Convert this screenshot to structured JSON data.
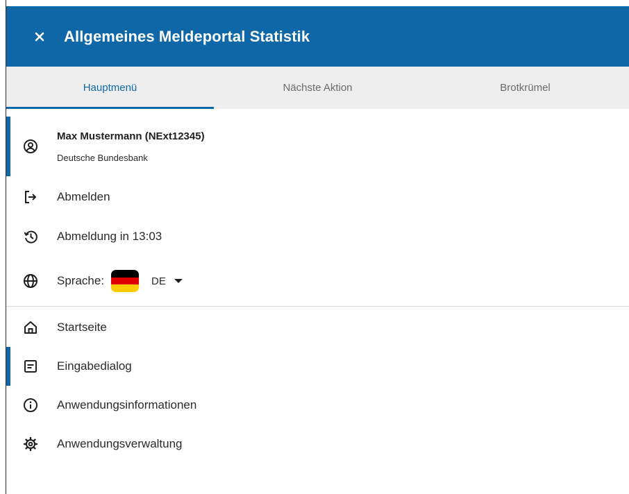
{
  "header": {
    "title": "Allgemeines Meldeportal Statistik",
    "close_icon": "close-icon",
    "background": "#0f67a7"
  },
  "tabs": [
    {
      "label": "Hauptmenü",
      "active": true
    },
    {
      "label": "Nächste Aktion",
      "active": false
    },
    {
      "label": "Brotkrümel",
      "active": false
    }
  ],
  "user": {
    "name": "Max Mustermann (NExt12345)",
    "organization": "Deutsche Bundesbank",
    "icon": "user-circle-icon"
  },
  "account_actions": [
    {
      "label": "Abmelden",
      "icon": "logout-icon"
    },
    {
      "label": "Abmeldung in 13:03",
      "icon": "history-icon"
    }
  ],
  "language": {
    "label": "Sprache:",
    "selected": "DE",
    "icon": "globe-icon",
    "flag": "germany-flag"
  },
  "menu": [
    {
      "label": "Startseite",
      "icon": "home-icon",
      "active": false
    },
    {
      "label": "Eingabedialog",
      "icon": "form-icon",
      "active": true
    },
    {
      "label": "Anwendungsinformationen",
      "icon": "info-icon",
      "active": false
    },
    {
      "label": "Anwendungsverwaltung",
      "icon": "settings-icon",
      "active": false
    }
  ],
  "colors": {
    "accent": "#0f67a7",
    "tab_bar": "#eeeeee"
  }
}
